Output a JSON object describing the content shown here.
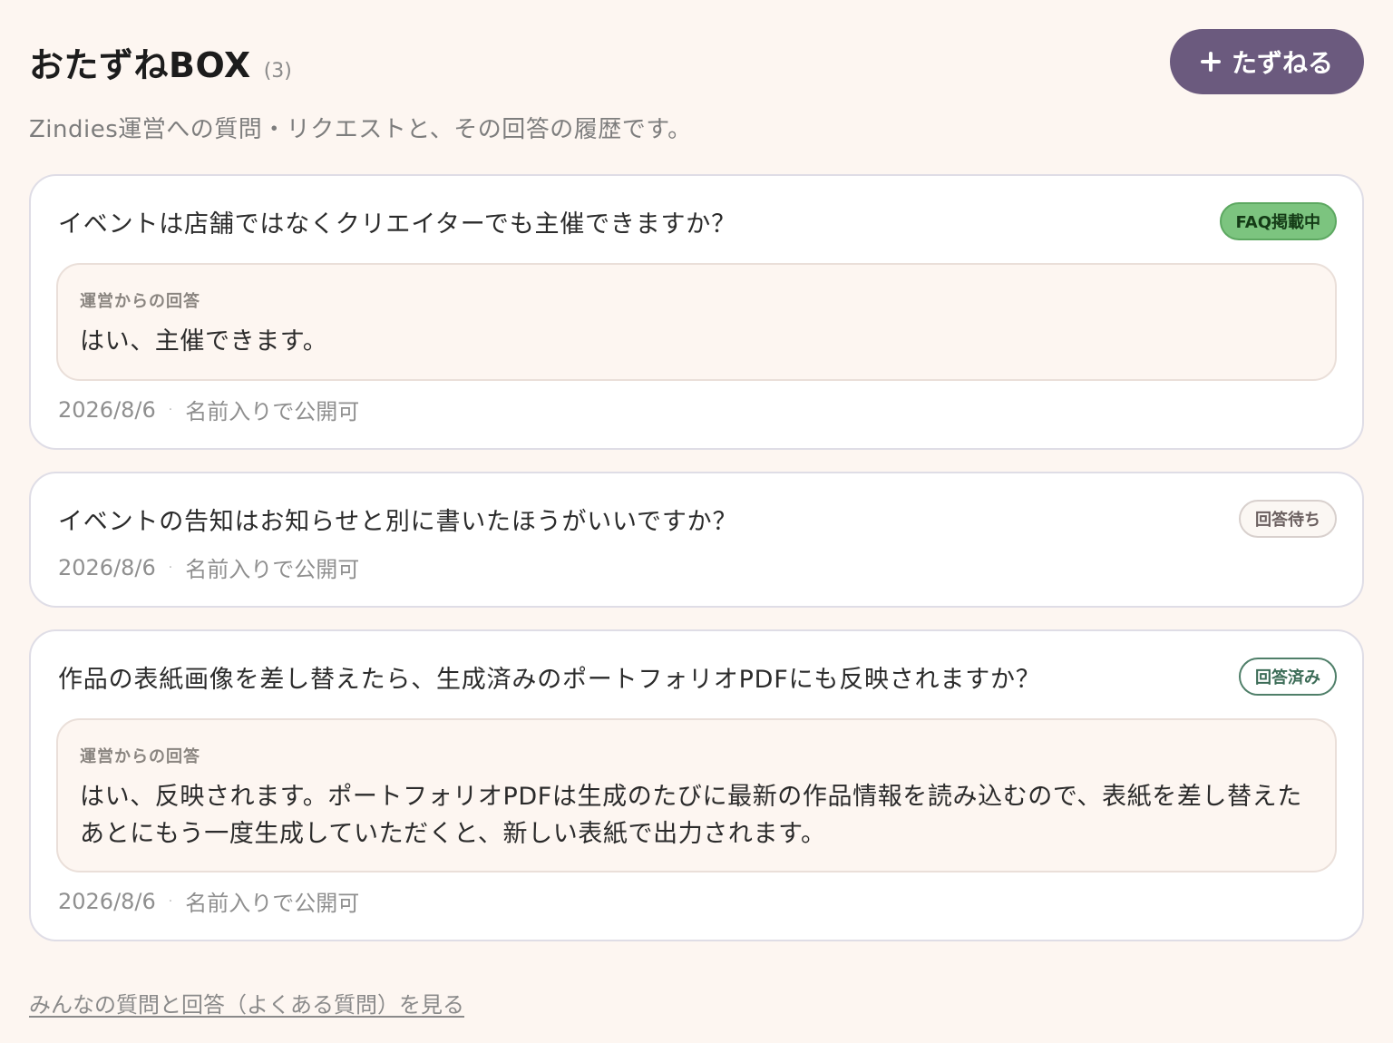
{
  "header": {
    "title": "おたずねBOX",
    "count": "(3)",
    "ask_button_label": "たずねる",
    "ask_button_icon": "plus-icon"
  },
  "subtitle": "Zindies運営への質問・リクエストと、その回答の履歴です。",
  "colors": {
    "background": "#fdf6f1",
    "accent": "#6b5a7e",
    "faq_badge": "#7cc47f",
    "answered_badge": "#4f7f69"
  },
  "questions": [
    {
      "question": "イベントは店舗ではなくクリエイターでも主催できますか？",
      "status": "FAQ掲載中",
      "answer_label": "運営からの回答",
      "answer": "はい、主催できます。",
      "date": "2026/8/6",
      "separator": "·",
      "visibility": "名前入りで公開可"
    },
    {
      "question": "イベントの告知はお知らせと別に書いたほうがいいですか？",
      "status": "回答待ち",
      "date": "2026/8/6",
      "separator": "·",
      "visibility": "名前入りで公開可"
    },
    {
      "question": "作品の表紙画像を差し替えたら、生成済みのポートフォリオPDFにも反映されますか？",
      "status": "回答済み",
      "answer_label": "運営からの回答",
      "answer": "はい、反映されます。ポートフォリオPDFは生成のたびに最新の作品情報を読み込むので、表紙を差し替えたあとにもう一度生成していただくと、新しい表紙で出力されます。",
      "date": "2026/8/6",
      "separator": "·",
      "visibility": "名前入りで公開可"
    }
  ],
  "footer": {
    "faq_link": "みんなの質問と回答（よくある質問）を見る"
  }
}
